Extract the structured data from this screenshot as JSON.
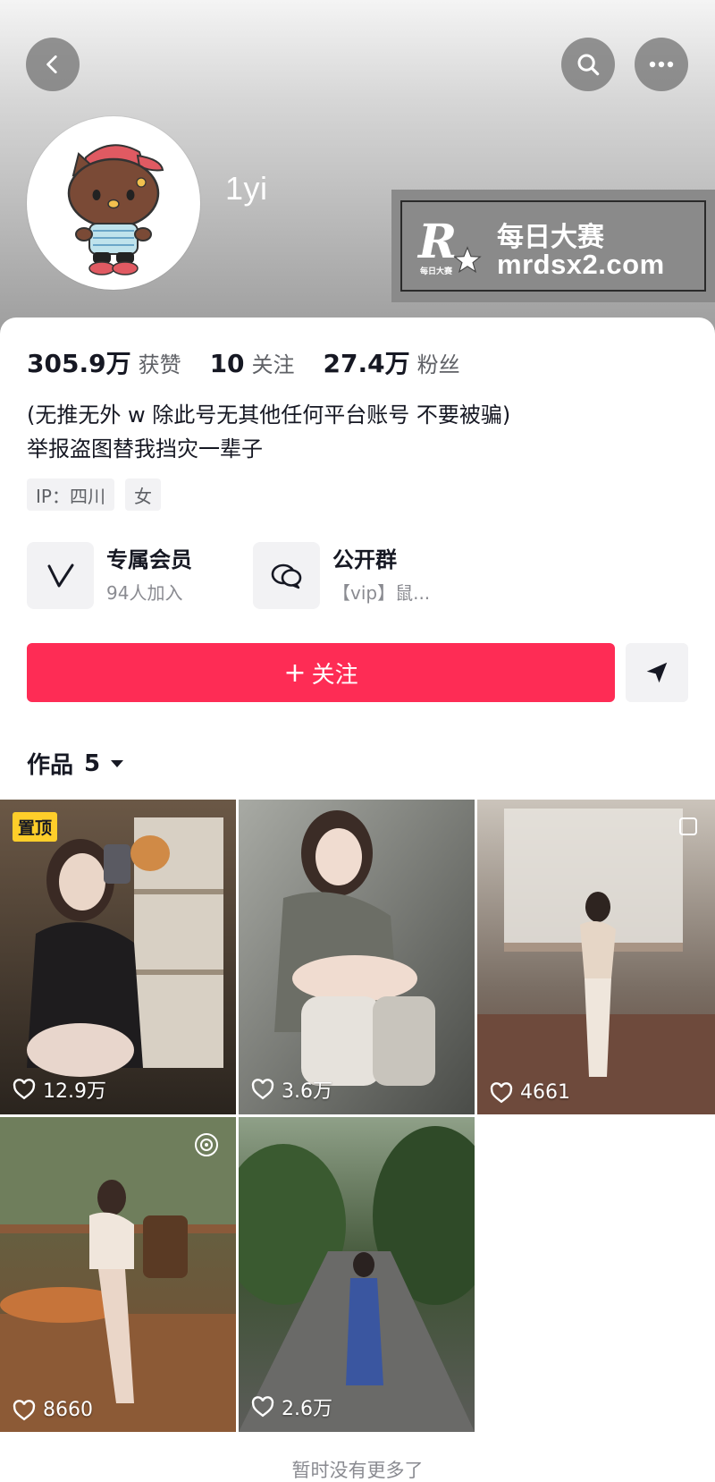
{
  "profile": {
    "username": "1yi",
    "stats": [
      {
        "num": "305.9万",
        "label": "获赞"
      },
      {
        "num": "10",
        "label": "关注"
      },
      {
        "num": "27.4万",
        "label": "粉丝"
      }
    ],
    "bio_line1": "(无推无外 w 除此号无其他任何平台账号 不要被骗)",
    "bio_line2": "举报盗图替我挡灾一辈子",
    "tags": [
      "IP：四川",
      "女"
    ]
  },
  "features": {
    "members": {
      "title": "专属会员",
      "sub": "94人加入"
    },
    "group": {
      "title": "公开群",
      "sub": "【vip】鼠..."
    }
  },
  "actions": {
    "follow_plus": "+",
    "follow_label": "关注"
  },
  "works": {
    "label": "作品",
    "count": "5"
  },
  "videos": [
    {
      "likes": "12.9万",
      "pinned_label": "置顶"
    },
    {
      "likes": "3.6万"
    },
    {
      "likes": "4661"
    },
    {
      "likes": "8660"
    },
    {
      "likes": "2.6万"
    }
  ],
  "footer": {
    "no_more": "暂时没有更多了"
  },
  "watermark": {
    "logo_letter": "R",
    "small_text": "每日大赛",
    "title": "每日大赛",
    "url": "mrdsx2.com"
  },
  "colors": {
    "accent": "#fe2c55",
    "pin_badge": "#fece2a"
  },
  "icons": [
    "back-icon",
    "search-icon",
    "more-icon",
    "vip-v-icon",
    "group-chat-icon",
    "send-icon",
    "chevron-down-icon",
    "heart-icon",
    "pin-icon"
  ]
}
